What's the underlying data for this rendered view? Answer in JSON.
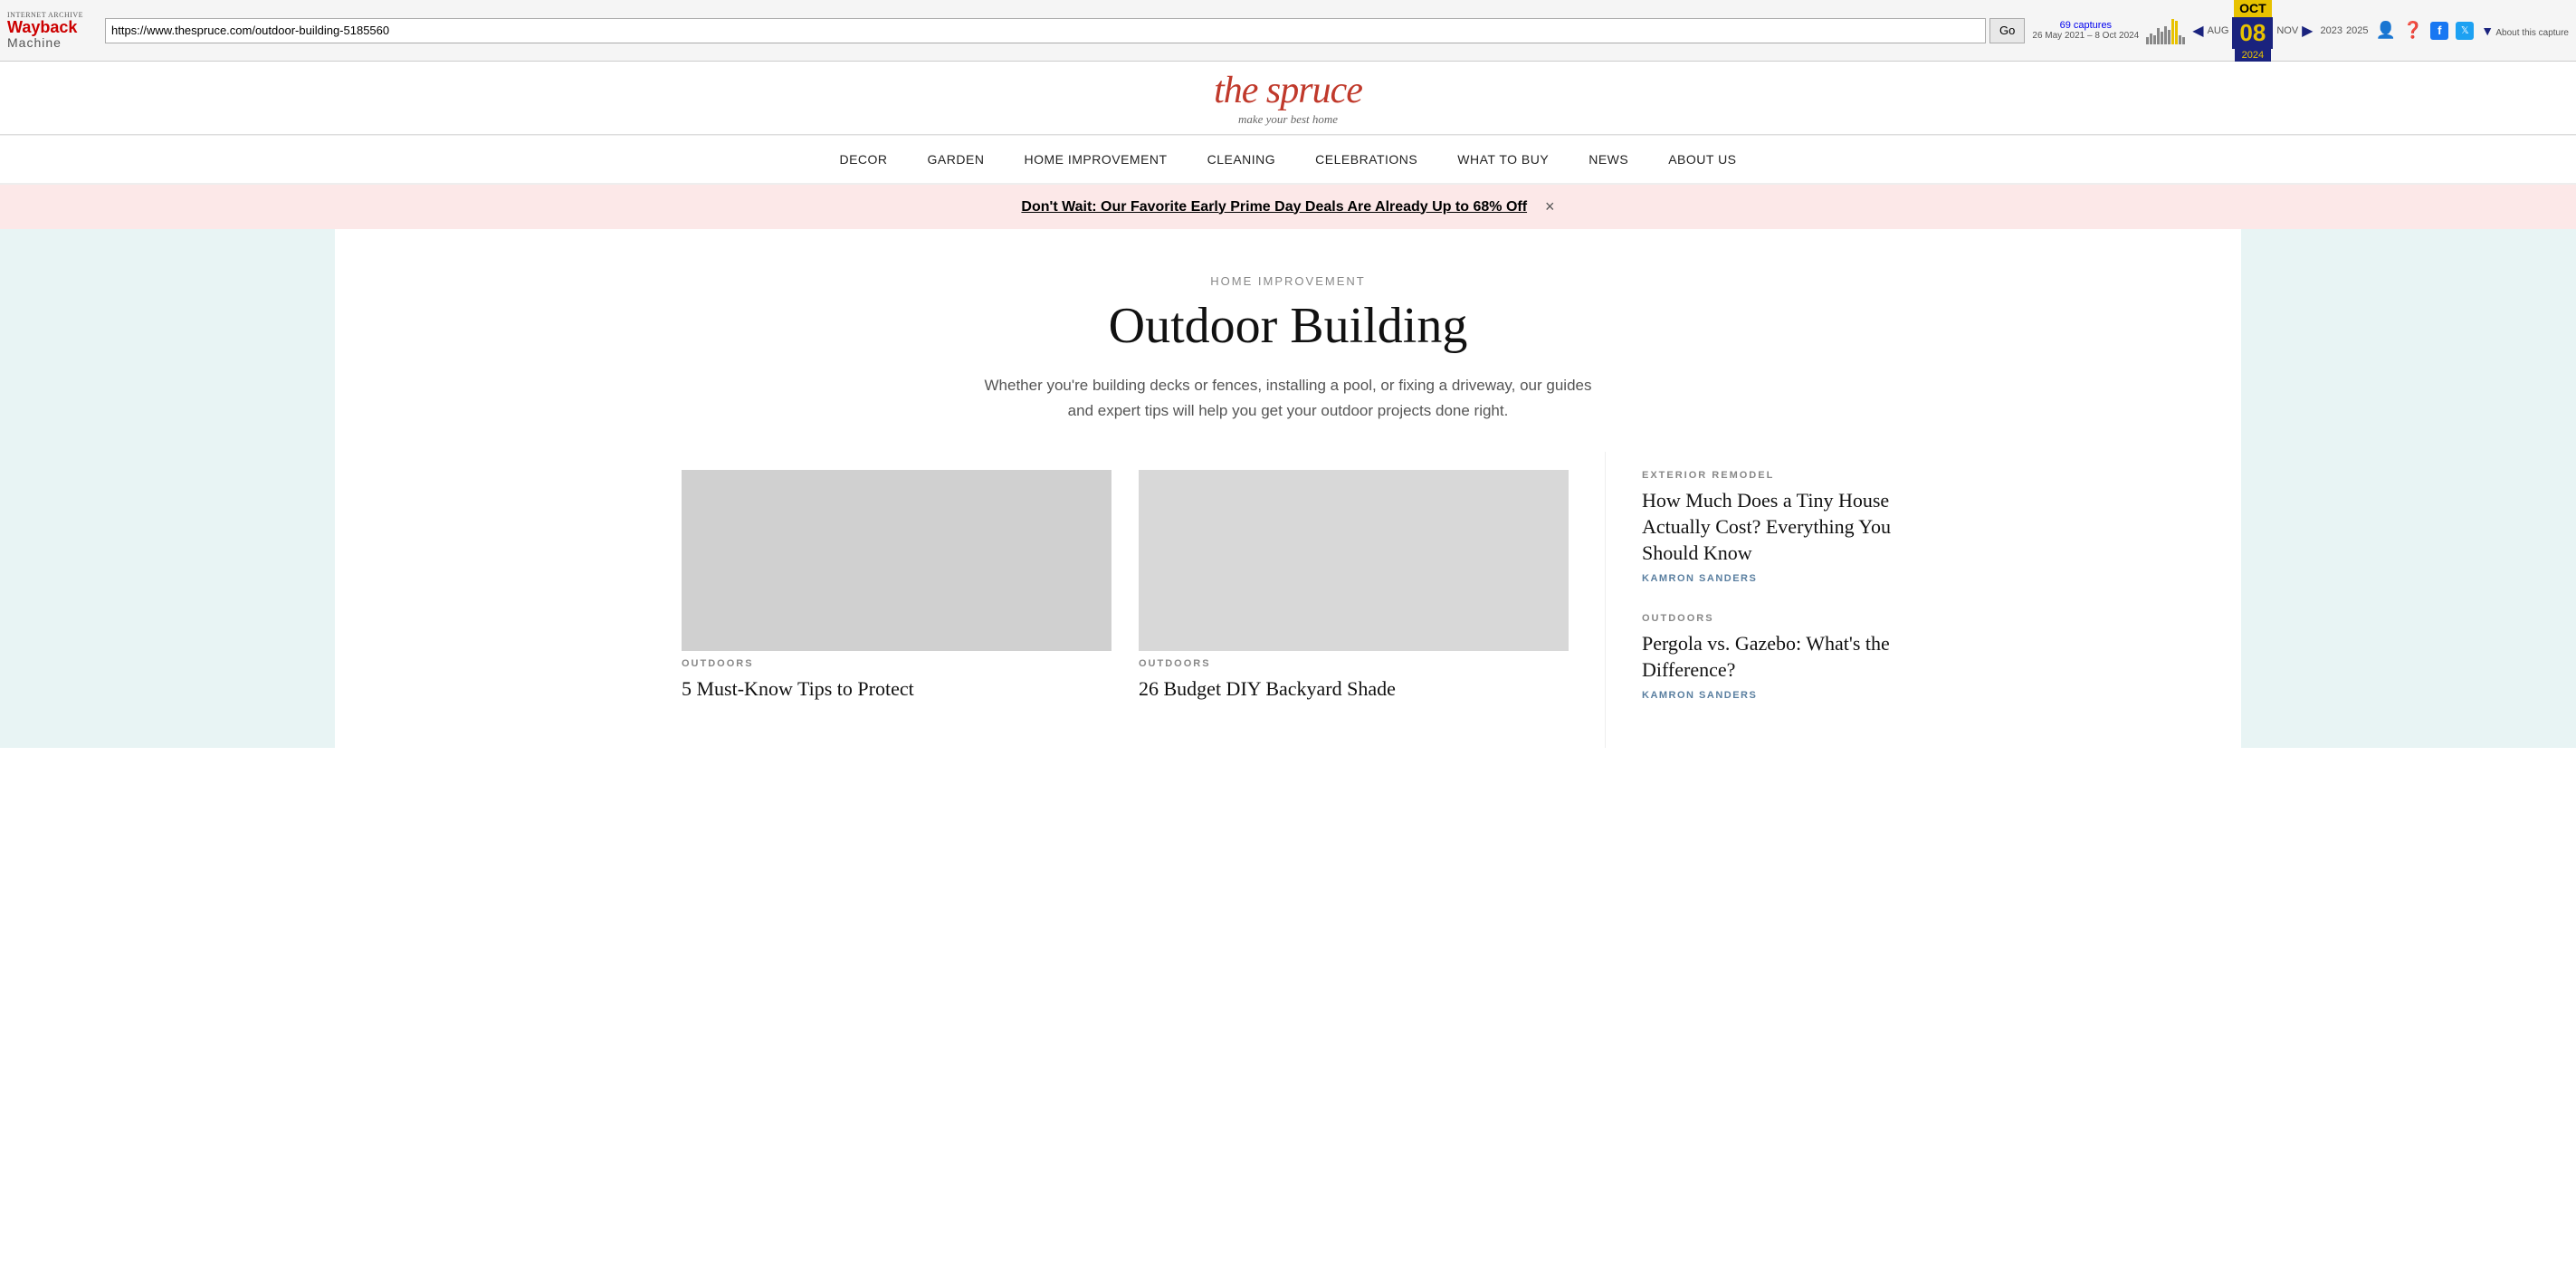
{
  "wayback": {
    "ia_label": "INTERNET ARCHIVE",
    "logo_text": "WayBack",
    "logo_text2": "Machine",
    "url": "https://www.thespruce.com/outdoor-building-5185560",
    "go_label": "Go",
    "captures_link": "69 captures",
    "captures_dates": "26 May 2021 – 8 Oct 2024",
    "year_prev": "AUG",
    "month_active": "OCT",
    "day_active": "08",
    "year_active": "2024",
    "year_next": "NOV",
    "year_left": "2023",
    "year_right": "2025",
    "about_capture": "About this capture"
  },
  "site": {
    "logo": "the spruce",
    "tagline": "make your best home"
  },
  "nav": {
    "items": [
      {
        "label": "DECOR"
      },
      {
        "label": "GARDEN"
      },
      {
        "label": "HOME IMPROVEMENT"
      },
      {
        "label": "CLEANING"
      },
      {
        "label": "CELEBRATIONS"
      },
      {
        "label": "WHAT TO BUY"
      },
      {
        "label": "NEWS"
      },
      {
        "label": "ABOUT US"
      }
    ]
  },
  "promo": {
    "text": "Don't Wait: Our Favorite Early Prime Day Deals Are Already Up to 68% Off",
    "close": "×"
  },
  "hero": {
    "category": "HOME IMPROVEMENT",
    "title": "Outdoor Building",
    "description": "Whether you're building decks or fences, installing a pool, or fixing a driveway, our guides and expert tips will help you get your outdoor projects done right."
  },
  "articles": [
    {
      "category": "OUTDOORS",
      "title": "5 Must-Know Tips to Protect"
    },
    {
      "category": "OUTDOORS",
      "title": "26 Budget DIY Backyard Shade"
    }
  ],
  "sidebar": {
    "articles": [
      {
        "category": "EXTERIOR REMODEL",
        "title": "How Much Does a Tiny House Actually Cost? Everything You Should Know",
        "author": "KAMRON SANDERS"
      },
      {
        "category": "OUTDOORS",
        "title": "Pergola vs. Gazebo: What's the Difference?",
        "author": "KAMRON SANDERS"
      }
    ]
  }
}
